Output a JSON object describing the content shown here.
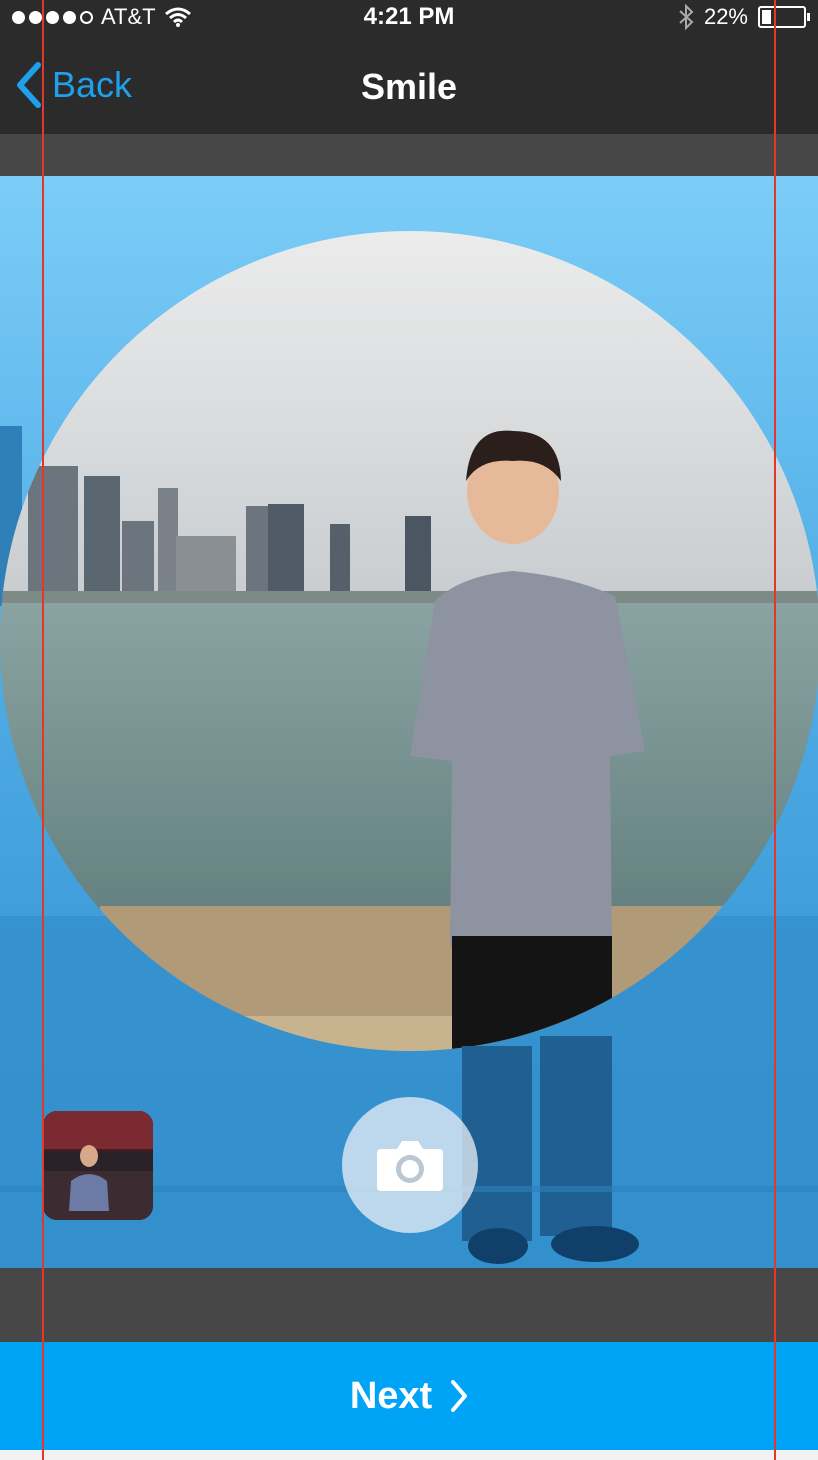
{
  "status_bar": {
    "carrier": "AT&T",
    "time": "4:21 PM",
    "battery": "22%",
    "signal_bars": 4,
    "battery_level": 0.22
  },
  "nav": {
    "back_label": "Back",
    "title": "Smile"
  },
  "camera": {
    "shutter_icon": "camera-icon",
    "thumbnail_icon": "photo-thumbnail"
  },
  "footer": {
    "next_label": "Next"
  },
  "colors": {
    "accent": "#00a4f6",
    "back_text": "#1ea0ea",
    "bar_bg": "#2b2b2b",
    "band_bg": "#474747",
    "guide_line": "#e0392b"
  }
}
